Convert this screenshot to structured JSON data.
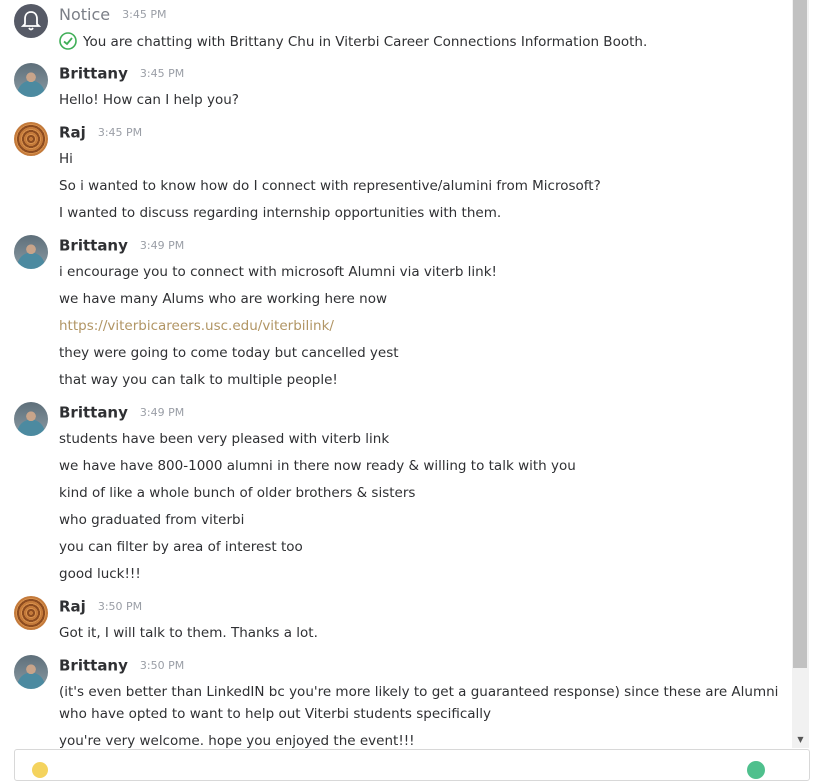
{
  "messages": [
    {
      "sender": "Notice",
      "time": "3:45 PM",
      "lines": [
        "You are chatting with Brittany Chu in Viterbi Career Connections Information Booth."
      ]
    },
    {
      "sender": "Brittany",
      "time": "3:45 PM",
      "lines": [
        "Hello! How can I help you?"
      ]
    },
    {
      "sender": "Raj",
      "time": "3:45 PM",
      "lines": [
        "Hi",
        "So i wanted to know how do I connect with representive/alumini from Microsoft?",
        "I wanted to discuss regarding internship opportunities with them."
      ]
    },
    {
      "sender": "Brittany",
      "time": "3:49 PM",
      "lines": [
        "i encourage you to connect with microsoft Alumni via viterb link!",
        "we have many Alums who are working here now",
        "https://viterbicareers.usc.edu/viterbilink/",
        "they were going to come today but cancelled yest",
        "that way you can talk to multiple people!"
      ]
    },
    {
      "sender": "Brittany",
      "time": "3:49 PM",
      "lines": [
        "students have been very pleased with viterb link",
        "we have have 800-1000 alumni in there now ready & willing to talk with you",
        "kind of like a whole bunch of older brothers & sisters",
        "who graduated from viterbi",
        "you can filter by area of interest too",
        "good luck!!!"
      ]
    },
    {
      "sender": "Raj",
      "time": "3:50 PM",
      "lines": [
        "Got it, I will talk to them. Thanks a lot."
      ]
    },
    {
      "sender": "Brittany",
      "time": "3:50 PM",
      "lines": [
        "(it's even better than LinkedIN bc you're more likely to get a guaranteed response) since these are Alumni who have opted to want to help out Viterbi students specifically",
        "you're very welcome. hope you enjoyed the event!!!"
      ]
    }
  ],
  "colors": {
    "link": "#b19564",
    "check": "#3fae57",
    "send": "#4fc08d"
  },
  "icons": {
    "notice_avatar": "bell-icon",
    "notice_check": "check-circle-icon",
    "scroll_down": "chevron-down-icon"
  }
}
